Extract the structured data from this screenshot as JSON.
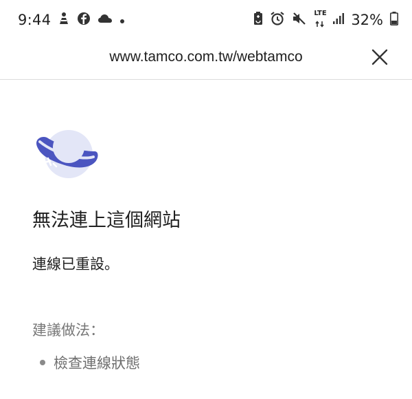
{
  "status_bar": {
    "time": "9:44",
    "battery_percent": "32%",
    "network_label": "LTE",
    "left_icons": [
      "app-notification-icon",
      "facebook-icon",
      "cloud-icon",
      "dot-icon"
    ],
    "right_icons": [
      "battery-saver-icon",
      "alarm-icon",
      "mute-icon",
      "lte-icon",
      "signal-icon",
      "battery-icon"
    ]
  },
  "address_bar": {
    "url": "www.tamco.com.tw/webtamco",
    "close_icon": "close-icon"
  },
  "error": {
    "illustration_icon": "planet-icon",
    "title": "無法連上這個網站",
    "message": "連線已重設。",
    "suggestions_heading": "建議做法：",
    "suggestions": [
      "檢查連線狀態"
    ]
  },
  "colors": {
    "accent": "#4b55c0",
    "planet_fill": "#e3e6f7",
    "text_primary": "#1f1f1f",
    "text_secondary": "#777777"
  }
}
